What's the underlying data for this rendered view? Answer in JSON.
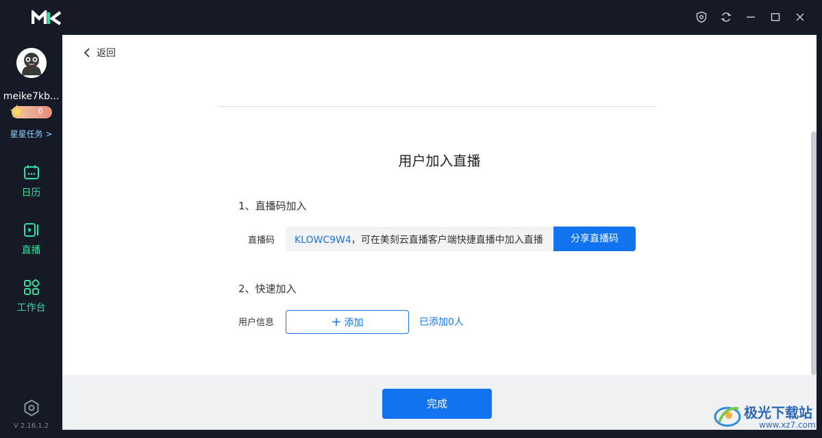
{
  "titlebar": {
    "logo_icon": "mk-logo",
    "controls": [
      "shield-icon",
      "sync-icon",
      "minimize-icon",
      "maximize-icon",
      "close-icon"
    ]
  },
  "sidebar": {
    "username": "meike7kb...",
    "stars": "0",
    "tasks_link": "星星任务 >",
    "nav": [
      {
        "label": "日历",
        "icon": "calendar-icon"
      },
      {
        "label": "直播",
        "icon": "live-icon"
      },
      {
        "label": "工作台",
        "icon": "workbench-icon"
      }
    ],
    "version": "V 2.16.1.2",
    "accent": "#34e0a0"
  },
  "main": {
    "back_label": "返回",
    "title": "用户加入直播",
    "section1": {
      "title": "1、直播码加入",
      "code_label": "直播码",
      "code": "KLOWC9W4",
      "code_desc": "，可在美刻云直播客户端快捷直播中加入直播",
      "share_label": "分享直播码"
    },
    "section2": {
      "title": "2、快速加入",
      "user_label": "用户信息",
      "add_label": "添加",
      "added_count": "已添加0人"
    },
    "done_label": "完成",
    "primary_color": "#1273f0"
  },
  "watermark": {
    "text": "极光下载站",
    "url": "www.xz7.com"
  }
}
